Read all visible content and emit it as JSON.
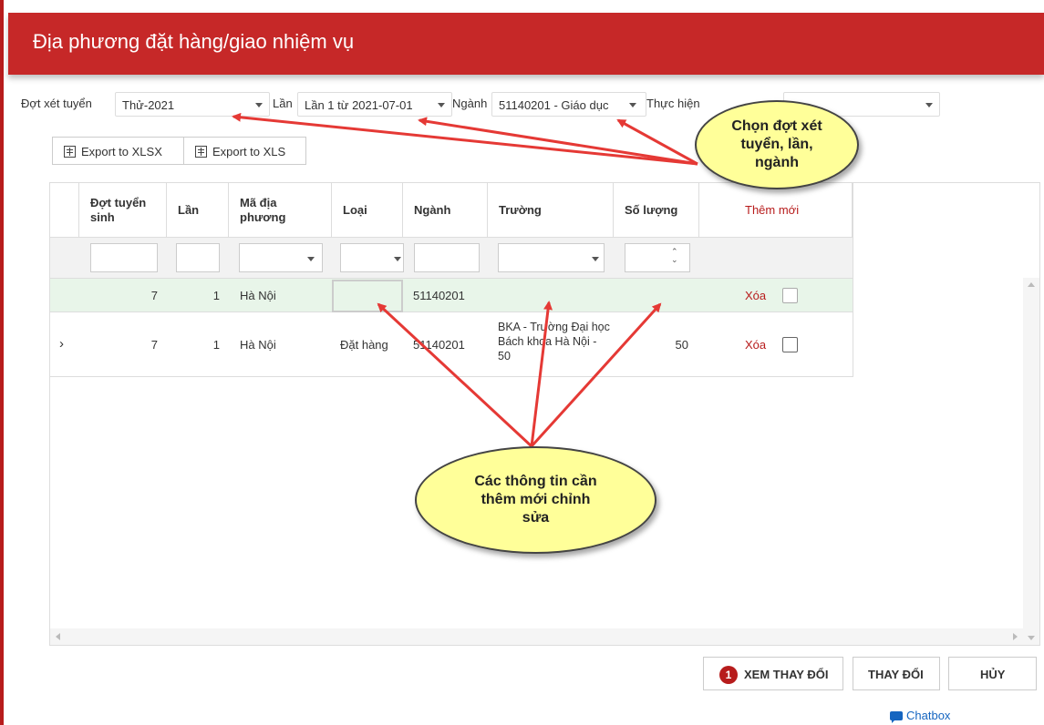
{
  "header": {
    "title": "Địa phương đặt hàng/giao nhiệm vụ"
  },
  "filters": {
    "dot_label": "Đợt xét tuyển",
    "dot_value": "Thử-2021",
    "lan_label": "Lần",
    "lan_value": "Lần 1 từ 2021-07-01",
    "nganh_label": "Ngành",
    "nganh_value": "51140201 - Giáo dục",
    "thuchien_label": "Thực hiện",
    "thuchien_value": ""
  },
  "toolbar": {
    "export_xlsx": "Export to XLSX",
    "export_xls": "Export to XLS"
  },
  "grid": {
    "columns": [
      "Đợt tuyển sinh",
      "Lần",
      "Mã địa phương",
      "Loại",
      "Ngành",
      "Trường",
      "Số lượng"
    ],
    "add_new": "Thêm mới",
    "rows": [
      {
        "dot": "7",
        "lan": "1",
        "ma": "Hà Nội",
        "loai": "",
        "nganh": "51140201",
        "truong": "",
        "so_luong": "",
        "action": "Xóa",
        "state": "new"
      },
      {
        "dot": "7",
        "lan": "1",
        "ma": "Hà Nội",
        "loai": "Đặt hàng",
        "nganh": "51140201",
        "truong": "BKA - Trường Đại học Bách khoa Hà Nội - 50",
        "so_luong": "50",
        "action": "Xóa",
        "state": "existing"
      }
    ]
  },
  "buttons": {
    "changes_count": "1",
    "view_changes": "XEM THAY ĐỔI",
    "apply": "THAY ĐỔI",
    "cancel": "HỦY"
  },
  "chatbox": {
    "label": "Chatbox"
  },
  "annotations": {
    "top_callout": "Chọn đợt xét tuyển, lần, ngành",
    "center_callout": "Các thông tin cần thêm mới chỉnh sửa"
  },
  "colors": {
    "brand": "#c62828",
    "new_row": "#e8f5e9",
    "callout": "#ffff99",
    "arrow": "#e53935"
  }
}
